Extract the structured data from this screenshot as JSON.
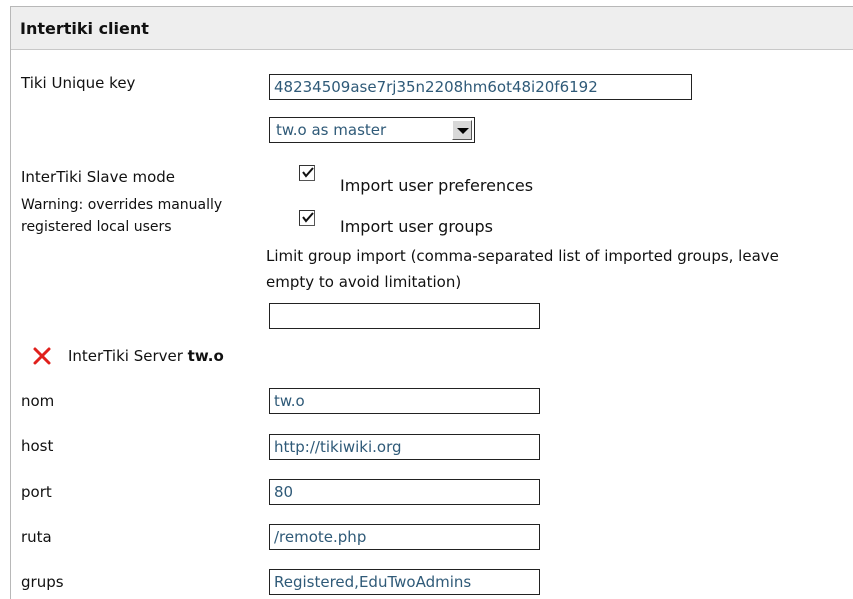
{
  "panel": {
    "title": "Intertiki client"
  },
  "unique_key": {
    "label": "Tiki Unique key",
    "value": "48234509ase7rj35n2208hm6ot48i20f6192"
  },
  "master_select": {
    "selected": "tw.o as master"
  },
  "slave_mode": {
    "label": "InterTiki Slave mode",
    "warning": "Warning: overrides manually registered local users",
    "import_prefs_label": "Import user preferences",
    "import_prefs_checked": true,
    "import_groups_label": "Import user groups",
    "import_groups_checked": true,
    "limit_text": "Limit group import (comma-separated list of imported groups, leave empty to avoid limitation)",
    "limit_value": ""
  },
  "server": {
    "prefix": "InterTiki Server",
    "name_bold": "tw.o",
    "delete_icon": "x-icon",
    "fields": {
      "nom": {
        "label": "nom",
        "value": "tw.o"
      },
      "host": {
        "label": "host",
        "value": "http://tikiwiki.org"
      },
      "port": {
        "label": "port",
        "value": "80"
      },
      "ruta": {
        "label": "ruta",
        "value": "/remote.php"
      },
      "grups": {
        "label": "grups",
        "value": "Registered,EduTwoAdmins"
      }
    }
  },
  "colors": {
    "header_bg": "#eeeeee",
    "input_text": "#2f5a78",
    "delete_icon": "#e0201c"
  }
}
